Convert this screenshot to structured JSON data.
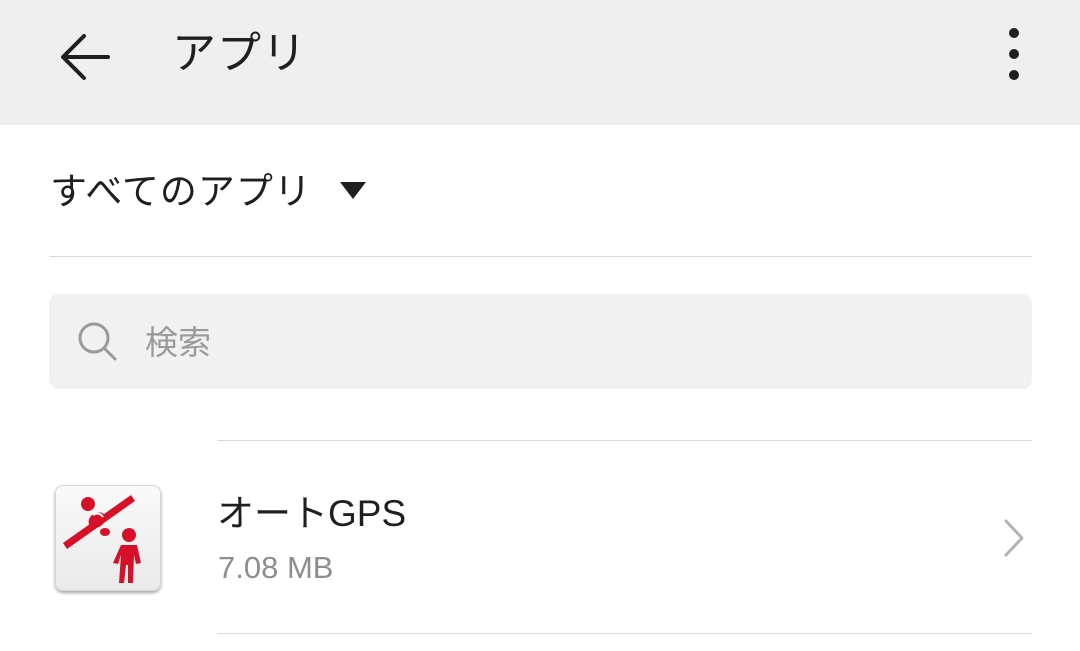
{
  "appbar": {
    "title": "アプリ",
    "back_icon": "arrow-back-icon",
    "more_icon": "more-vert-icon"
  },
  "filter": {
    "label": "すべてのアプリ",
    "caret_icon": "caret-down-icon"
  },
  "search": {
    "placeholder": "検索",
    "value": "",
    "icon": "search-icon"
  },
  "apps": [
    {
      "name": "オートGPS",
      "size": "7.08 MB",
      "icon": "auto-gps-app-icon",
      "icon_color": "#d7102a"
    }
  ],
  "colors": {
    "appbar_bg": "#efefef",
    "text_primary": "#1f1f1f",
    "text_secondary": "#8e8e8e",
    "search_bg": "#f1f1f1",
    "divider": "#d9d9d9"
  }
}
